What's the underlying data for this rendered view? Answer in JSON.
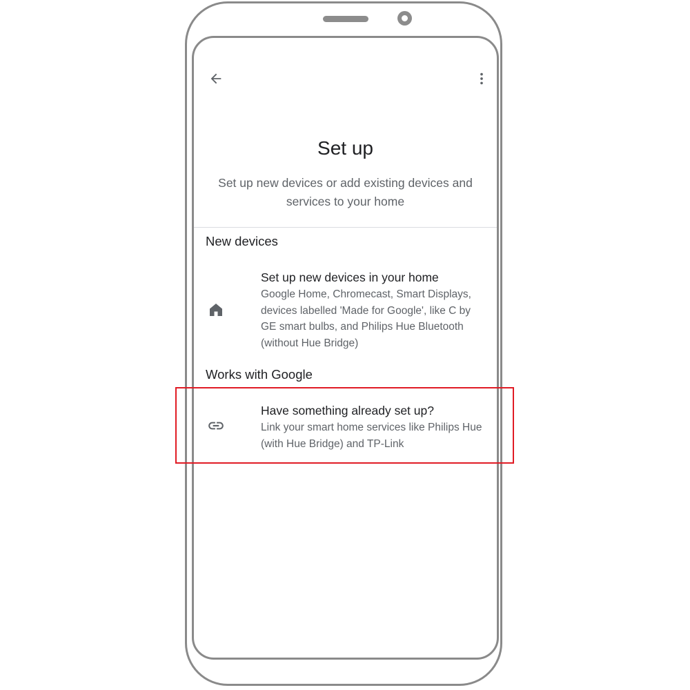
{
  "screen": {
    "title": "Set up",
    "subtitle": "Set up new devices or add existing devices and services to your home"
  },
  "toolbar": {
    "back_icon": "arrow-back-icon",
    "more_icon": "more-vert-icon"
  },
  "sections": [
    {
      "header": "New devices",
      "items": [
        {
          "icon": "home-icon",
          "title": "Set up new devices in your home",
          "description": "Google Home, Chromecast, Smart Displays, devices labelled 'Made for Google', like C by GE smart bulbs, and Philips Hue Bluetooth (without Hue Bridge)"
        }
      ]
    },
    {
      "header": "Works with Google",
      "items": [
        {
          "icon": "link-icon",
          "title": "Have something already set up?",
          "description": "Link your smart home services like Philips Hue (with Hue Bridge) and TP-Link"
        }
      ]
    }
  ],
  "colors": {
    "highlight": "#e01b24",
    "frame": "#8a8a8a",
    "text_primary": "#202124",
    "text_secondary": "#5f6368"
  }
}
